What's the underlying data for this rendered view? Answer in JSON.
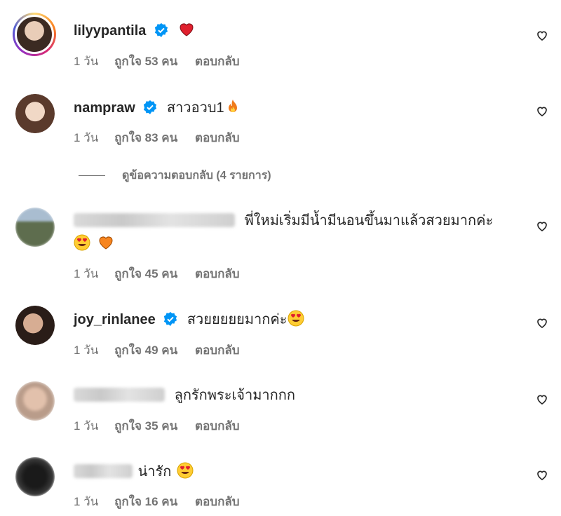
{
  "comments": [
    {
      "username": "lilyypantila",
      "text": "",
      "emoji": [
        "red-heart"
      ],
      "time": "1 วัน",
      "likes": "ถูกใจ 53 คน",
      "reply": "ตอบกลับ"
    },
    {
      "username": "nampraw",
      "text": "สาวอวบ1",
      "emoji": [
        "fire"
      ],
      "time": "1 วัน",
      "likes": "ถูกใจ 83 คน",
      "reply": "ตอบกลับ"
    },
    {
      "username": "",
      "text": "พี่ใหม่เริ่มมีน้ำมีนอนขึ้นมาแล้วสวยมากค่ะ",
      "emoji": [
        "heart-eyes",
        "orange-heart"
      ],
      "time": "1 วัน",
      "likes": "ถูกใจ 45 คน",
      "reply": "ตอบกลับ"
    },
    {
      "username": "joy_rinlanee",
      "text": "สวยยยยยมากค่ะ",
      "emoji": [
        "heart-eyes"
      ],
      "time": "1 วัน",
      "likes": "ถูกใจ 49 คน",
      "reply": "ตอบกลับ"
    },
    {
      "username": "",
      "text": "ลูกรักพระเจ้ามากกก",
      "emoji": [],
      "time": "1 วัน",
      "likes": "ถูกใจ 35 คน",
      "reply": "ตอบกลับ"
    },
    {
      "username": "",
      "text": "น่ารัก",
      "emoji": [
        "heart-eyes"
      ],
      "time": "1 วัน",
      "likes": "ถูกใจ 16 คน",
      "reply": "ตอบกลับ"
    }
  ],
  "view_replies": "ดูข้อความตอบกลับ (4 รายการ)",
  "colors": {
    "text": "#262626",
    "secondary": "#737373",
    "verified": "#0095f6"
  }
}
